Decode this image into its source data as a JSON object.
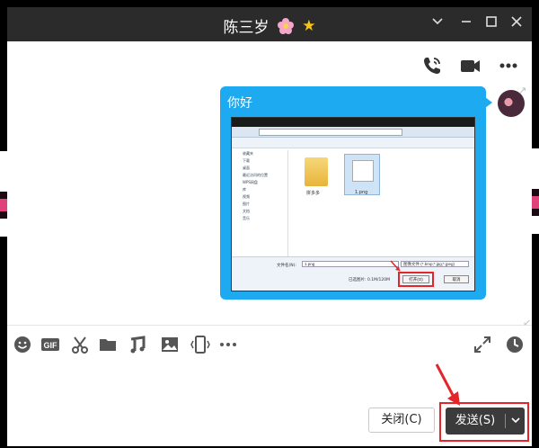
{
  "window": {
    "title": "陈三岁",
    "controls": [
      "chevron-down-icon",
      "minimize-icon",
      "maximize-icon",
      "close-icon"
    ]
  },
  "header_actions": [
    "voice-call-icon",
    "video-call-icon",
    "more-icon"
  ],
  "message": {
    "text": "你好",
    "bubble_color": "#1eaaf1",
    "screenshot": {
      "breadcrumb": [
        "用户",
        "Administrator",
        "桌面"
      ],
      "search_placeholder": "搜索 桌面",
      "toolbar": [
        "组织 ▾",
        "新建文件夹"
      ],
      "sidebar": [
        "收藏夹",
        "下载",
        "桌面",
        "最近访问的位置",
        "WPS网盘",
        "库",
        "视频",
        "图片",
        "文档",
        "音乐"
      ],
      "files": [
        {
          "name": "拼多多",
          "type": "folder"
        },
        {
          "name": "1.png",
          "type": "image",
          "selected": true
        }
      ],
      "filename_label": "文件名(N):",
      "filename_value": "1.png",
      "filter_value": "图像文件 (*.bmp;*.jpg;*.jpeg)",
      "size_label": "已选图片: 0.1M/120M",
      "open_label": "打开(O)",
      "cancel_label": "取消"
    }
  },
  "toolbar_icons": [
    "emoji-icon",
    "gif-icon",
    "scissors-icon",
    "folder-icon",
    "music-note-icon",
    "image-icon",
    "shake-icon",
    "more-icon",
    "expand-icon",
    "history-icon"
  ],
  "buttons": {
    "close": "关闭(C)",
    "send": "发送(S)",
    "send_caret": "﹀"
  },
  "colors": {
    "titlebar": "#2b2b2b",
    "send_button": "#3b3b3b",
    "highlight": "#e3262a",
    "accent": "#1eaaf1"
  }
}
